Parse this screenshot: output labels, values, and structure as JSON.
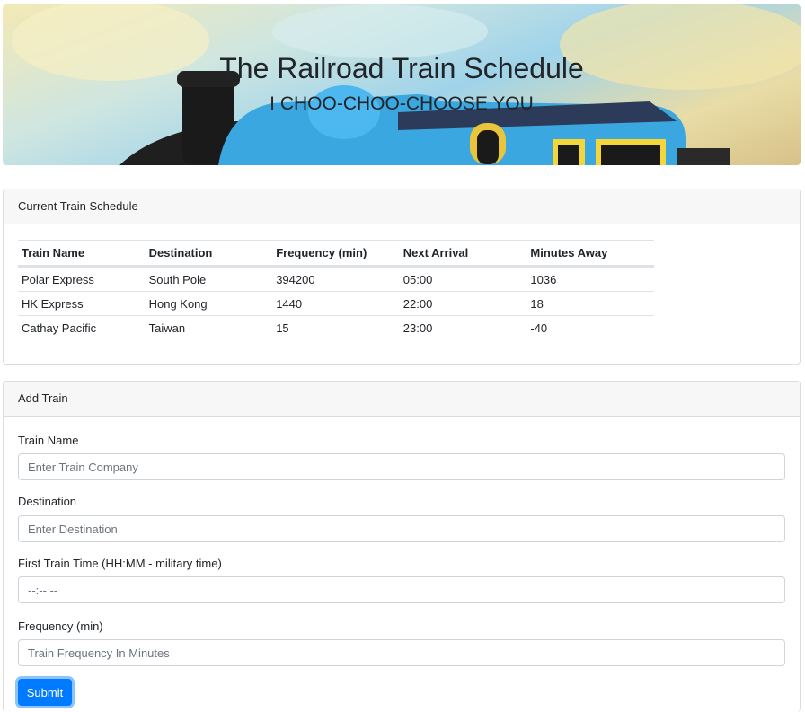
{
  "header": {
    "title": "The Railroad Train Schedule",
    "subtitle": "I CHOO-CHOO-CHOOSE YOU"
  },
  "schedule": {
    "heading": "Current Train Schedule",
    "columns": [
      "Train Name",
      "Destination",
      "Frequency (min)",
      "Next Arrival",
      "Minutes Away"
    ],
    "rows": [
      [
        "Polar Express",
        "South Pole",
        "394200",
        "05:00",
        "1036"
      ],
      [
        "HK Express",
        "Hong Kong",
        "1440",
        "22:00",
        "18"
      ],
      [
        "Cathay Pacific",
        "Taiwan",
        "15",
        "23:00",
        "-40"
      ]
    ]
  },
  "add_train": {
    "heading": "Add Train",
    "fields": [
      {
        "label": "Train Name",
        "placeholder": "Enter Train Company"
      },
      {
        "label": "Destination",
        "placeholder": "Enter Destination"
      },
      {
        "label": "First Train Time (HH:MM - military time)",
        "placeholder": "--:-- --"
      },
      {
        "label": "Frequency (min)",
        "placeholder": "Train Frequency In Minutes"
      }
    ],
    "submit_label": "Submit"
  },
  "colors": {
    "primary": "#007bff",
    "header_bg": "#f7f7f7",
    "train_body": "#3aa7e0",
    "train_dark": "#1a1a1a"
  }
}
